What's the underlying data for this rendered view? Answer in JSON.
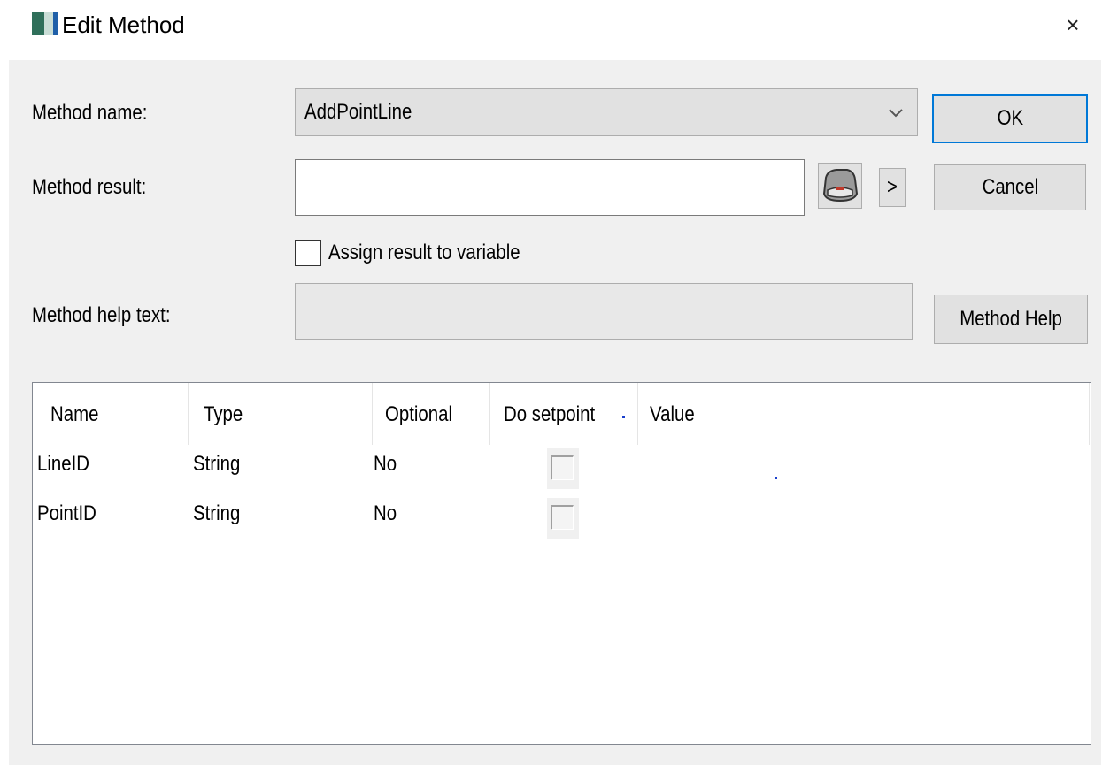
{
  "window": {
    "title": "Edit Method",
    "close_glyph": "×"
  },
  "form": {
    "method_name_label": "Method name:",
    "method_name_value": "AddPointLine",
    "method_result_label": "Method result:",
    "method_result_value": "",
    "assign_checkbox_label": "Assign result to variable",
    "assign_checked": false,
    "help_text_label": "Method help text:",
    "help_text_value": ""
  },
  "buttons": {
    "ok": "OK",
    "cancel": "Cancel",
    "method_help": "Method Help",
    "arrow": ">"
  },
  "table": {
    "columns": [
      "Name",
      "Type",
      "Optional",
      "Do setpoint",
      "Value"
    ],
    "rows": [
      {
        "name": "LineID",
        "type": "String",
        "optional": "No",
        "do_setpoint": false,
        "value": ""
      },
      {
        "name": "PointID",
        "type": "String",
        "optional": "No",
        "do_setpoint": false,
        "value": ""
      }
    ]
  },
  "icons": {
    "app": "app-window-icon",
    "close": "close-icon",
    "dropdown": "chevron-down-icon",
    "browse": "variable-browse-icon"
  },
  "colors": {
    "focus_border": "#0078d7",
    "dialog_bg": "#f0f0f0",
    "button_bg": "#e1e1e1"
  }
}
